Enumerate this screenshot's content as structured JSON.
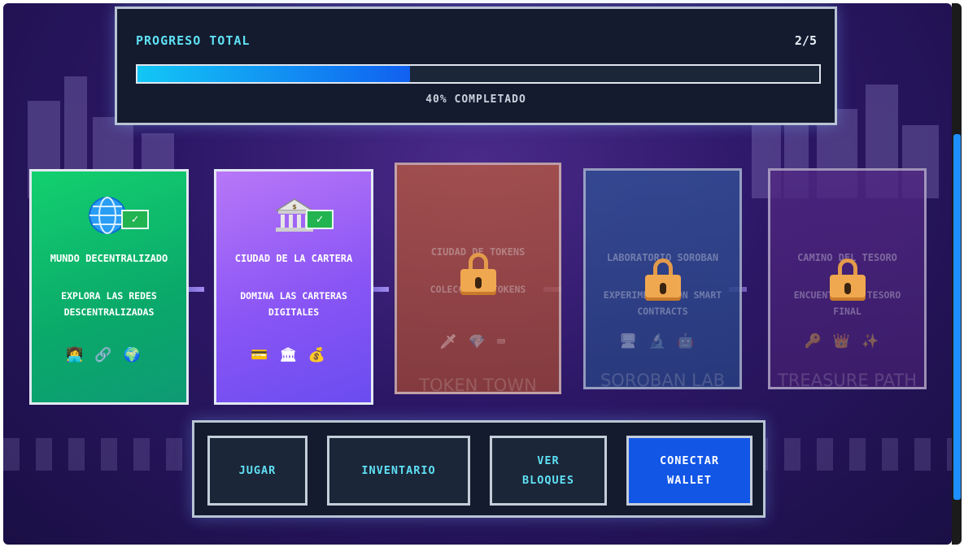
{
  "progress": {
    "title": "PROGRESO TOTAL",
    "count": "2/5",
    "percent": 40,
    "label": "40% COMPLETADO"
  },
  "worlds": [
    {
      "title": "MUNDO DECENTRALIZADO",
      "desc": "EXPLORA LAS REDES DESCENTRALIZADAS",
      "icon": "globe-icon",
      "status": "completed",
      "items": [
        "👩‍💻",
        "🔗",
        "🌍"
      ],
      "color": "#10c46a"
    },
    {
      "title": "CIUDAD DE LA CARTERA",
      "desc": "DOMINA LAS CARTERAS DIGITALES",
      "icon": "bank-icon",
      "status": "completed",
      "items": [
        "💳",
        "🏛",
        "💰"
      ],
      "color": "#9b5cf6"
    },
    {
      "title": "CIUDAD DE TOKENS",
      "desc": "COLECCIONA TOKENS",
      "status": "locked",
      "items": [
        "🗡",
        "💎",
        "⌨"
      ],
      "background_label": "TOKEN TOWN",
      "color": "#b4553a"
    },
    {
      "title": "LABORATORIO SOROBAN",
      "desc": "EXPERIMENTA CON SMART CONTRACTS",
      "status": "locked",
      "items": [
        "🖥",
        "🔬",
        "🤖"
      ],
      "background_label": "SOROBAN LAB",
      "color": "#2d4a8a"
    },
    {
      "title": "CAMINO DEL TESORO",
      "desc": "ENCUENTRA EL TESORO FINAL",
      "status": "locked",
      "items": [
        "🔑",
        "👑",
        "✨"
      ],
      "background_label": "TREASURE PATH",
      "color": "#4a2878"
    }
  ],
  "actions": {
    "play": "JUGAR",
    "inventory": "INVENTARIO",
    "view_blocks_line1": "VER",
    "view_blocks_line2": "BLOQUES",
    "connect_line1": "CONECTAR",
    "connect_line2": "WALLET"
  }
}
